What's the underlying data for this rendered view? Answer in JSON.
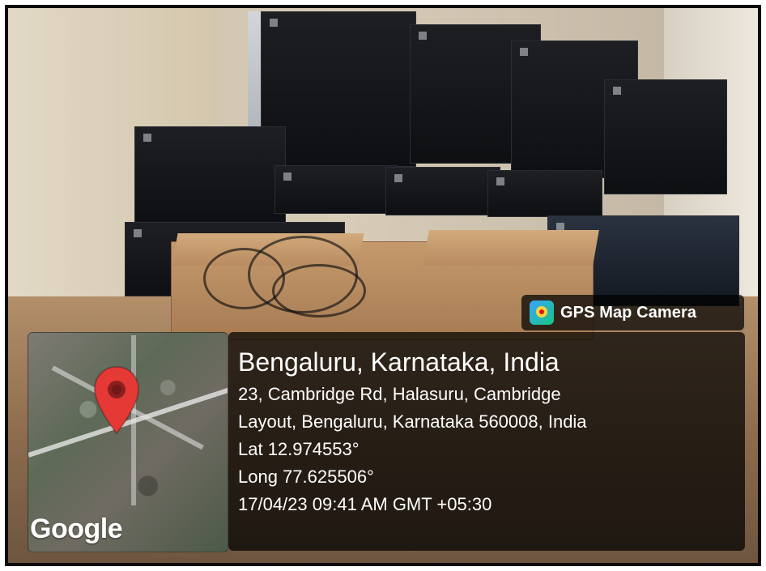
{
  "overlay": {
    "brand_label": "GPS Map Camera",
    "map": {
      "watermark": "Google"
    },
    "location": {
      "title": "Bengaluru, Karnataka, India",
      "address_line_1": "23, Cambridge Rd, Halasuru, Cambridge",
      "address_line_2": "Layout, Bengaluru, Karnataka 560008, India",
      "latitude": "Lat 12.974553°",
      "longitude": "Long 77.625506°",
      "timestamp": "17/04/23 09:41 AM GMT +05:30"
    },
    "icons": {
      "brand_icon": "gps-map-camera-icon",
      "map_pin_icon": "map-pin-icon"
    },
    "colors": {
      "panel": "#000000",
      "text": "#ffffff",
      "pin": "#e53935"
    }
  }
}
